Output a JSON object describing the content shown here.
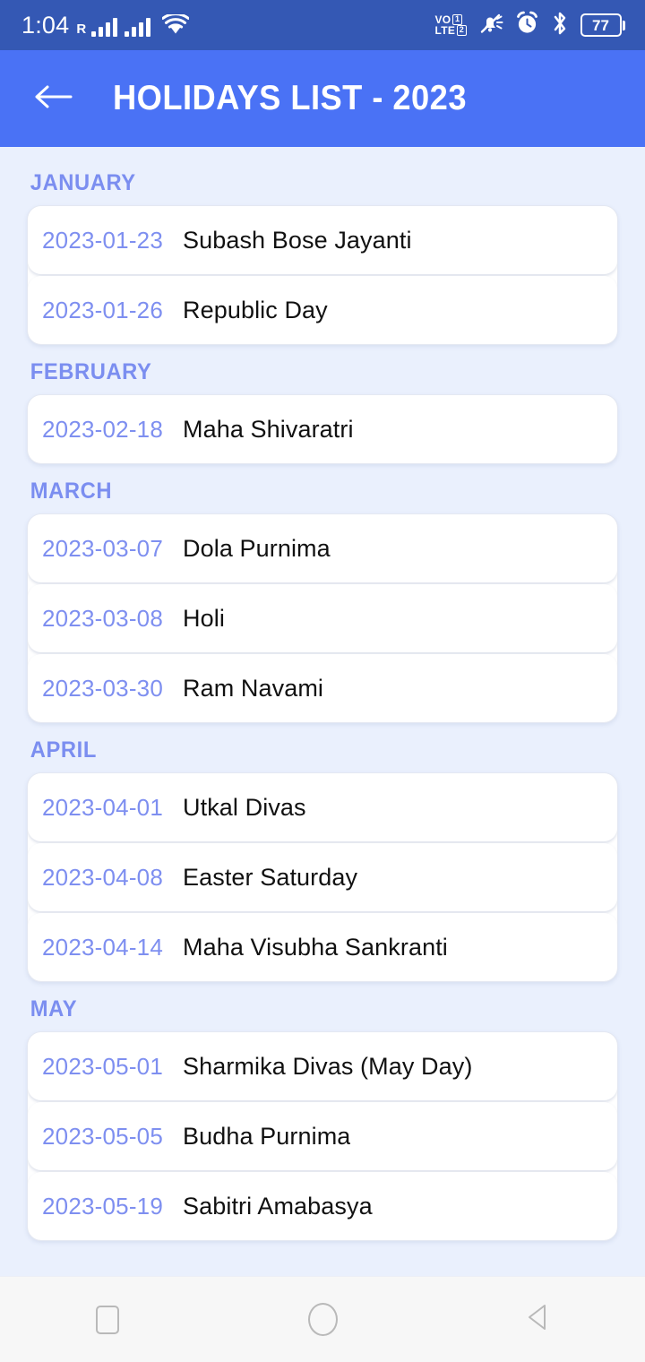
{
  "status_bar": {
    "time": "1:04",
    "roaming_label": "R",
    "network_label_top": "VO",
    "network_label_bottom": "LTE",
    "sim_slot_1": "1",
    "sim_slot_2": "2",
    "battery_level": "77",
    "icons": [
      "signal-bars-sim1",
      "signal-bars-sim2",
      "wifi-icon",
      "volte-icon",
      "mute-bell-icon",
      "alarm-clock-icon",
      "bluetooth-icon",
      "battery-icon"
    ]
  },
  "app_bar": {
    "title": "HOLIDAYS LIST - 2023",
    "back_icon": "arrow-left-icon",
    "background_color": "#4a72f5"
  },
  "theme": {
    "page_background": "#eaf0fd",
    "accent_blue": "#4a72f5",
    "status_bar_blue": "#3458b4",
    "month_label_color": "#7b8ef0",
    "date_text_color": "#7e8ff0",
    "holiday_text_color": "#111111",
    "card_background": "#ffffff"
  },
  "months": [
    {
      "label": "JANUARY",
      "holidays": [
        {
          "date": "2023-01-23",
          "name": "Subash Bose Jayanti"
        },
        {
          "date": "2023-01-26",
          "name": "Republic Day"
        }
      ]
    },
    {
      "label": "FEBRUARY",
      "holidays": [
        {
          "date": "2023-02-18",
          "name": "Maha Shivaratri"
        }
      ]
    },
    {
      "label": "MARCH",
      "holidays": [
        {
          "date": "2023-03-07",
          "name": "Dola Purnima"
        },
        {
          "date": "2023-03-08",
          "name": "Holi"
        },
        {
          "date": "2023-03-30",
          "name": "Ram Navami"
        }
      ]
    },
    {
      "label": "APRIL",
      "holidays": [
        {
          "date": "2023-04-01",
          "name": "Utkal Divas"
        },
        {
          "date": "2023-04-08",
          "name": "Easter Saturday"
        },
        {
          "date": "2023-04-14",
          "name": "Maha Visubha Sankranti"
        }
      ]
    },
    {
      "label": "MAY",
      "holidays": [
        {
          "date": "2023-05-01",
          "name": "Sharmika Divas (May Day)"
        },
        {
          "date": "2023-05-05",
          "name": "Budha Purnima"
        },
        {
          "date": "2023-05-19",
          "name": "Sabitri Amabasya"
        }
      ]
    }
  ],
  "nav_bar": {
    "recents_label": "Recents",
    "home_label": "Home",
    "back_label": "Back"
  }
}
